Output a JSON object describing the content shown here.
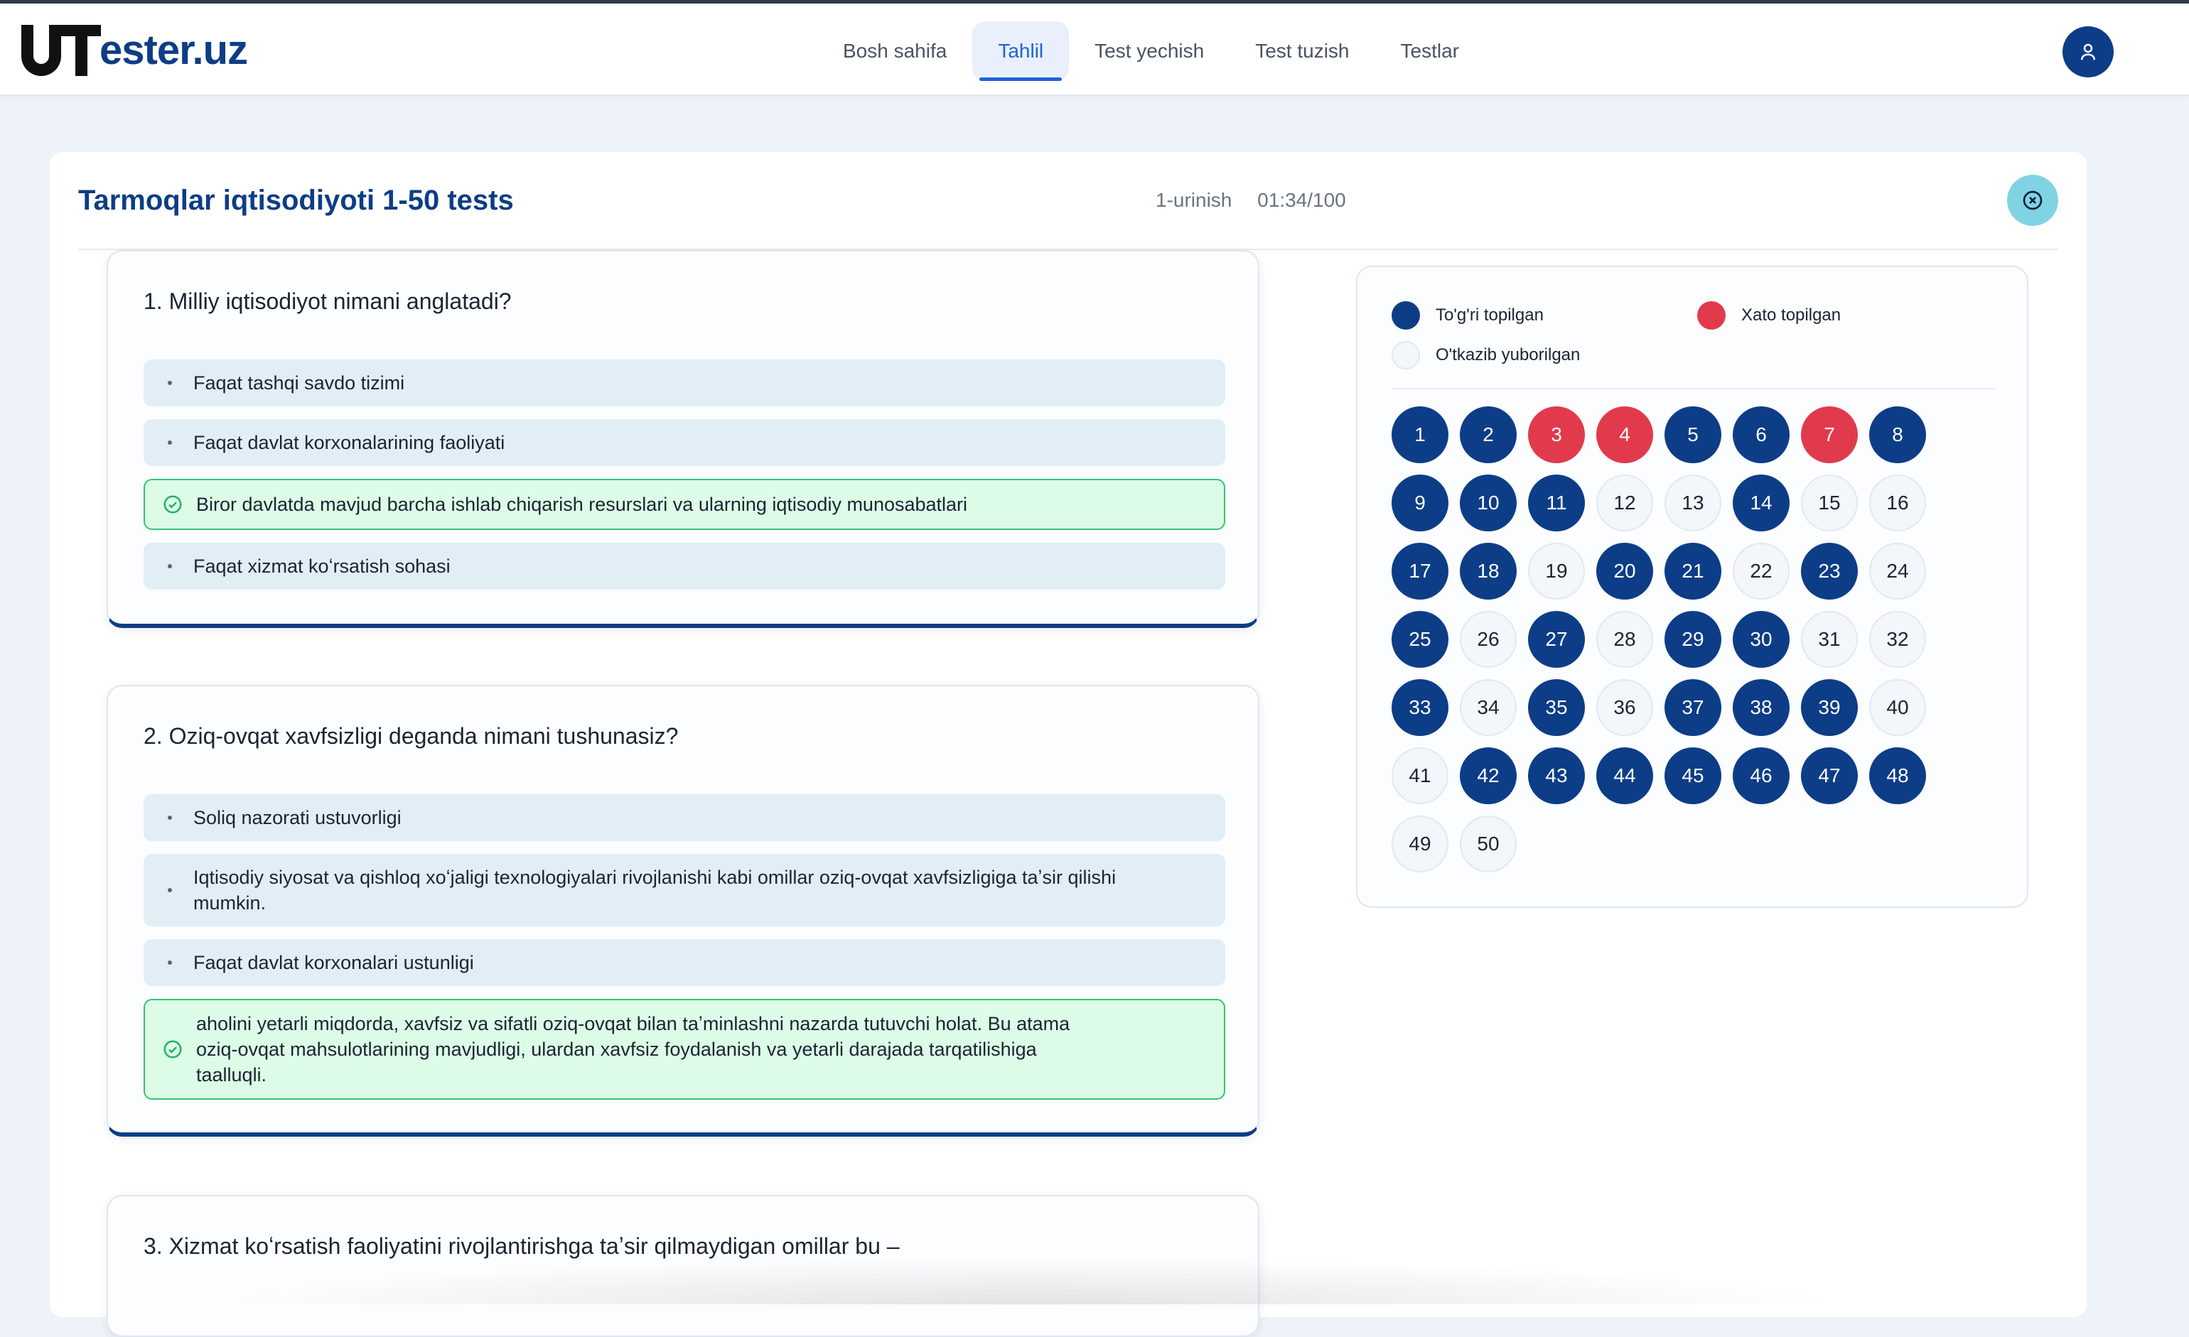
{
  "header": {
    "logo_text": "ester.uz",
    "nav": [
      "Bosh sahifa",
      "Tahlil",
      "Test yechish",
      "Test tuzish",
      "Testlar"
    ],
    "active_nav": "Tahlil"
  },
  "test": {
    "title": "Tarmoqlar iqtisodiyoti 1-50 tests",
    "attempt": "1-urinish",
    "timer": "01:34/100"
  },
  "questions": [
    {
      "text": "1. Milliy iqtisodiyot nimani anglatadi?",
      "options": [
        {
          "text": "Faqat tashqi savdo tizimi",
          "correct": false
        },
        {
          "text": "Faqat davlat korxonalarining faoliyati",
          "correct": false
        },
        {
          "text": "Biror davlatda mavjud barcha ishlab chiqarish resurslari va ularning iqtisodiy munosabatlari",
          "correct": true
        },
        {
          "text": "Faqat xizmat koʻrsatish sohasi",
          "correct": false
        }
      ]
    },
    {
      "text": "2. Oziq-ovqat xavfsizligi deganda nimani tushunasiz?",
      "options": [
        {
          "text": "Soliq nazorati ustuvorligi",
          "correct": false
        },
        {
          "text": "Iqtisodiy siyosat va qishloq xoʻjaligi texnologiyalari rivojlanishi kabi omillar oziq-ovqat xavfsizligiga taʼsir qilishi mumkin.",
          "correct": false
        },
        {
          "text": "Faqat davlat korxonalari ustunligi",
          "correct": false
        },
        {
          "text": "aholini yetarli miqdorda, xavfsiz va sifatli oziq-ovqat bilan taʼminlashni nazarda tutuvchi holat. Bu atama oziq-ovqat mahsulotlarining mavjudligi, ulardan xavfsiz foydalanish va yetarli darajada tarqatilishiga taalluqli.",
          "correct": true
        }
      ]
    },
    {
      "text": "3. Xizmat koʻrsatish faoliyatini rivojlantirishga taʼsir qilmaydigan omillar bu –",
      "options": []
    }
  ],
  "legend": {
    "correct": "To'g'ri topilgan",
    "wrong": "Xato topilgan",
    "skipped": "O'tkazib yuborilgan"
  },
  "colors": {
    "correct": "#0d3d86",
    "wrong": "#e23a4d",
    "skipped": "#f3f6fa",
    "accent": "#1d62d9"
  },
  "answers": [
    {
      "n": "1",
      "s": "c"
    },
    {
      "n": "2",
      "s": "c"
    },
    {
      "n": "3",
      "s": "w"
    },
    {
      "n": "4",
      "s": "w"
    },
    {
      "n": "5",
      "s": "c"
    },
    {
      "n": "6",
      "s": "c"
    },
    {
      "n": "7",
      "s": "w"
    },
    {
      "n": "8",
      "s": "c"
    },
    {
      "n": "9",
      "s": "c"
    },
    {
      "n": "10",
      "s": "c"
    },
    {
      "n": "11",
      "s": "c"
    },
    {
      "n": "12",
      "s": "s"
    },
    {
      "n": "13",
      "s": "s"
    },
    {
      "n": "14",
      "s": "c"
    },
    {
      "n": "15",
      "s": "s"
    },
    {
      "n": "16",
      "s": "s"
    },
    {
      "n": "17",
      "s": "c"
    },
    {
      "n": "18",
      "s": "c"
    },
    {
      "n": "19",
      "s": "s"
    },
    {
      "n": "20",
      "s": "c"
    },
    {
      "n": "21",
      "s": "c"
    },
    {
      "n": "22",
      "s": "s"
    },
    {
      "n": "23",
      "s": "c"
    },
    {
      "n": "24",
      "s": "s"
    },
    {
      "n": "25",
      "s": "c"
    },
    {
      "n": "26",
      "s": "s"
    },
    {
      "n": "27",
      "s": "c"
    },
    {
      "n": "28",
      "s": "s"
    },
    {
      "n": "29",
      "s": "c"
    },
    {
      "n": "30",
      "s": "c"
    },
    {
      "n": "31",
      "s": "s"
    },
    {
      "n": "32",
      "s": "s"
    },
    {
      "n": "33",
      "s": "c"
    },
    {
      "n": "34",
      "s": "s"
    },
    {
      "n": "35",
      "s": "c"
    },
    {
      "n": "36",
      "s": "s"
    },
    {
      "n": "37",
      "s": "c"
    },
    {
      "n": "38",
      "s": "c"
    },
    {
      "n": "39",
      "s": "c"
    },
    {
      "n": "40",
      "s": "s"
    },
    {
      "n": "41",
      "s": "s"
    },
    {
      "n": "42",
      "s": "c"
    },
    {
      "n": "43",
      "s": "c"
    },
    {
      "n": "44",
      "s": "c"
    },
    {
      "n": "45",
      "s": "c"
    },
    {
      "n": "46",
      "s": "c"
    },
    {
      "n": "47",
      "s": "c"
    },
    {
      "n": "48",
      "s": "c"
    },
    {
      "n": "49",
      "s": "s"
    },
    {
      "n": "50",
      "s": "s"
    }
  ]
}
